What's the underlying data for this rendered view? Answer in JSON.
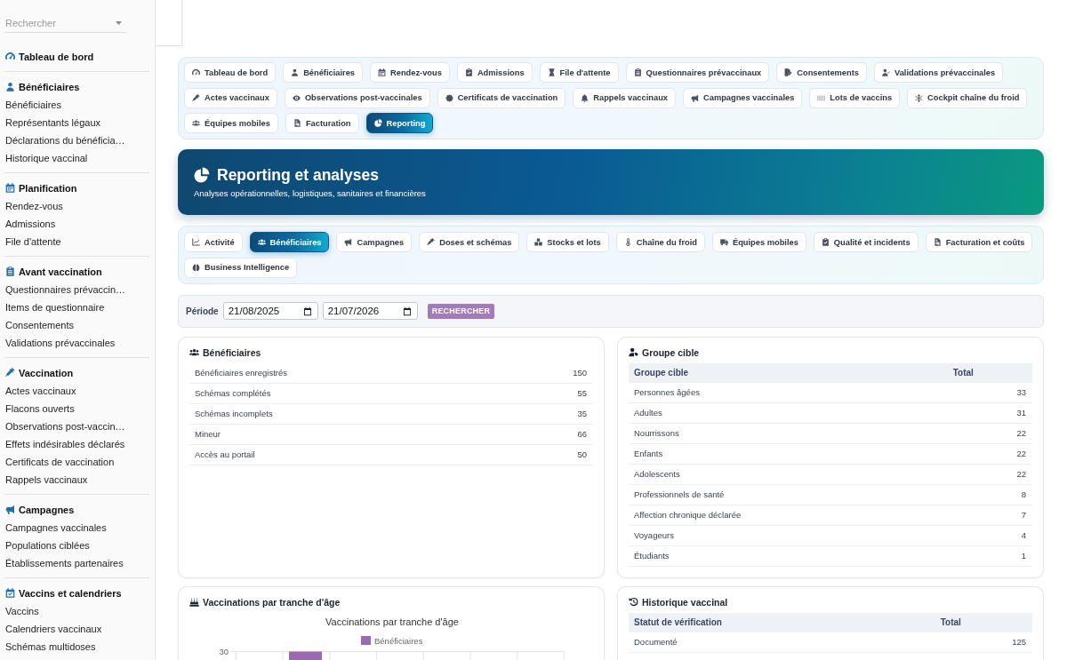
{
  "sidebar": {
    "search": {
      "placeholder": "Rechercher"
    },
    "sections": [
      {
        "title": "Tableau de bord"
      },
      {
        "title": "Bénéficiaires",
        "items": [
          "Bénéficiaires",
          "Représentants légaux",
          "Déclarations du bénéficia…",
          "Historique vaccinal"
        ]
      },
      {
        "title": "Planification",
        "items": [
          "Rendez-vous",
          "Admissions",
          "File d'attente"
        ]
      },
      {
        "title": "Avant vaccination",
        "items": [
          "Questionnaires prévaccin…",
          "Items de questionnaire",
          "Consentements",
          "Validations prévaccinales"
        ]
      },
      {
        "title": "Vaccination",
        "items": [
          "Actes vaccinaux",
          "Flacons ouverts",
          "Observations post-vaccin…",
          "Effets indésirables déclarés",
          "Certificats de vaccination",
          "Rappels vaccinaux"
        ]
      },
      {
        "title": "Campagnes",
        "items": [
          "Campagnes vaccinales",
          "Populations ciblées",
          "Établissements partenaires"
        ]
      },
      {
        "title": "Vaccins et calendriers",
        "items": [
          "Vaccins",
          "Calendriers vaccinaux",
          "Schémas multidoses"
        ]
      }
    ]
  },
  "nav_tabs": [
    {
      "label": "Tableau de bord",
      "selected": false
    },
    {
      "label": "Bénéficiaires",
      "selected": false
    },
    {
      "label": "Rendez-vous",
      "selected": false
    },
    {
      "label": "Admissions",
      "selected": false
    },
    {
      "label": "File d'attente",
      "selected": false
    },
    {
      "label": "Questionnaires prévaccinaux",
      "selected": false
    },
    {
      "label": "Consentements",
      "selected": false
    },
    {
      "label": "Validations prévaccinales",
      "selected": false
    },
    {
      "label": "Actes vaccinaux",
      "selected": false
    },
    {
      "label": "Observations post-vaccinales",
      "selected": false
    },
    {
      "label": "Certificats de vaccination",
      "selected": false
    },
    {
      "label": "Rappels vaccinaux",
      "selected": false
    },
    {
      "label": "Campagnes vaccinales",
      "selected": false
    },
    {
      "label": "Lots de vaccins",
      "selected": false
    },
    {
      "label": "Cockpit chaîne du froid",
      "selected": false
    },
    {
      "label": "Équipes mobiles",
      "selected": false
    },
    {
      "label": "Facturation",
      "selected": false
    },
    {
      "label": "Reporting",
      "selected": true
    }
  ],
  "hero": {
    "title": "Reporting et analyses",
    "subtitle": "Analyses opérationnelles, logistiques, sanitaires et financières"
  },
  "report_tabs": [
    {
      "label": "Activité",
      "selected": false
    },
    {
      "label": "Bénéficiaires",
      "selected": true
    },
    {
      "label": "Campagnes",
      "selected": false
    },
    {
      "label": "Doses et schémas",
      "selected": false
    },
    {
      "label": "Stocks et lots",
      "selected": false
    },
    {
      "label": "Chaîne du froid",
      "selected": false
    },
    {
      "label": "Équipes mobiles",
      "selected": false
    },
    {
      "label": "Qualité et incidents",
      "selected": false
    },
    {
      "label": "Facturation et coûts",
      "selected": false
    },
    {
      "label": "Business Intelligence",
      "selected": false
    }
  ],
  "period": {
    "label": "Période",
    "from": "21/08/2025",
    "to": "21/07/2026",
    "button": "RECHERCHER"
  },
  "beneficiaries_card": {
    "title": "Bénéficiaires",
    "rows": [
      {
        "label": "Bénéficiaires enregistrés",
        "value": "150"
      },
      {
        "label": "Schémas complétés",
        "value": "55"
      },
      {
        "label": "Schémas incomplets",
        "value": "35"
      },
      {
        "label": "Mineur",
        "value": "66"
      },
      {
        "label": "Accès au portail",
        "value": "50"
      }
    ]
  },
  "target_group_card": {
    "title": "Groupe cible",
    "columns": [
      "Groupe cible",
      "Total"
    ],
    "rows": [
      [
        "Personnes âgées",
        "33"
      ],
      [
        "Adultes",
        "31"
      ],
      [
        "Nourrissons",
        "22"
      ],
      [
        "Enfants",
        "22"
      ],
      [
        "Adolescents",
        "22"
      ],
      [
        "Professionnels de santé",
        "8"
      ],
      [
        "Affection chronique déclarée",
        "7"
      ],
      [
        "Voyageurs",
        "4"
      ],
      [
        "Étudiants",
        "1"
      ]
    ]
  },
  "age_chart_card": {
    "title": "Vaccinations par tranche d'âge",
    "chart_title": "Vaccinations par tranche d'âge",
    "legend": [
      {
        "label": "Bénéficiaires",
        "color": "#9b69b0"
      }
    ],
    "y_tick_labels": [
      "30"
    ]
  },
  "history_card": {
    "title": "Historique vaccinal",
    "columns": [
      "Statut de vérification",
      "Total"
    ],
    "rows": [
      [
        "Documenté",
        "125"
      ]
    ]
  }
}
